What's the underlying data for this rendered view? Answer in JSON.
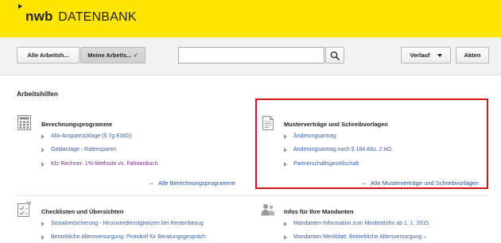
{
  "header": {
    "logo_brand": "nwb",
    "logo_product": "DATENBANK",
    "background_color": "#ffe500"
  },
  "toolbar": {
    "alle_arbeitshilfen_label": "Alle Arbeitsh...",
    "meine_arbeitshilfen_label": "Meine Arbeits... ✓",
    "search_value": "",
    "search_icon": "magnifier-icon",
    "verlauf_label": "Verlauf",
    "akten_label": "Akten"
  },
  "main": {
    "section_title": "Arbeitshilfen",
    "panels": {
      "berechnungsprogramme": {
        "icon": "calculator-icon",
        "heading": "Berechnungsprogramme",
        "items": [
          "AfA-Ansparrücklage (§ 7g EStG)",
          "Geldanlage - Ratensparen",
          "Kfz-Rechner: 1%-Methode vs. Fahrtenbuch"
        ],
        "more_link": "Alle Berechnungsprogramme"
      },
      "mustervertraege": {
        "icon": "document-icon",
        "heading": "Musterverträge und Schreibvorlagen",
        "items": [
          "Änderungsantrag",
          "Änderungsantrag nach § 164 Abs. 2 AO",
          "Partnerschaftsgesellschaft"
        ],
        "more_link": "Alle Musterverträge und Schreibvorlagen",
        "highlight_color": "#d8141b"
      },
      "checklisten": {
        "icon": "checklist-icon",
        "heading": "Checklisten und Übersichten",
        "items": [
          "Sozialversicherung - Hinzuverdienstgrenzen bei Rentenbezug",
          "Betriebliche Altersversorgung: Protokoll für Beratungsgespräch"
        ]
      },
      "mandanten": {
        "icon": "people-icon",
        "heading": "Infos für Ihre Mandanten",
        "items": [
          "Mandanten-Information zum Mindestlohn ab 1. 1. 2015",
          "Mandanten-Merkblatt: Betriebliche Altersversorgung –"
        ]
      }
    }
  }
}
